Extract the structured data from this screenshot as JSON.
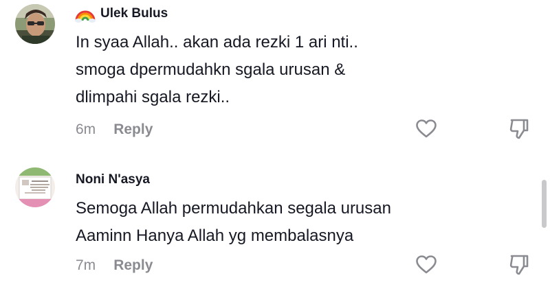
{
  "comments": [
    {
      "username": "Ulek Bulus",
      "text_lines": [
        "In syaa Allah.. akan ada rezki 1 ari nti..",
        "smoga dpermudahkn sgala urusan &",
        "dlimpahi sgala rezki.."
      ],
      "time": "6m",
      "reply_label": "Reply",
      "flag_icon": "rainbow-emoji"
    },
    {
      "username": "Noni N'asya",
      "text_lines": [
        "Semoga Allah permudahkan segala urusan",
        "Aaminn Hanya Allah yg membalasnya"
      ],
      "time": "7m",
      "reply_label": "Reply"
    }
  ],
  "icons": {
    "like": "heart-outline-icon",
    "dislike": "thumbs-down-icon"
  },
  "colors": {
    "text": "#161823",
    "meta": "#8a8b91",
    "scrollbar": "#c9c9cc"
  }
}
